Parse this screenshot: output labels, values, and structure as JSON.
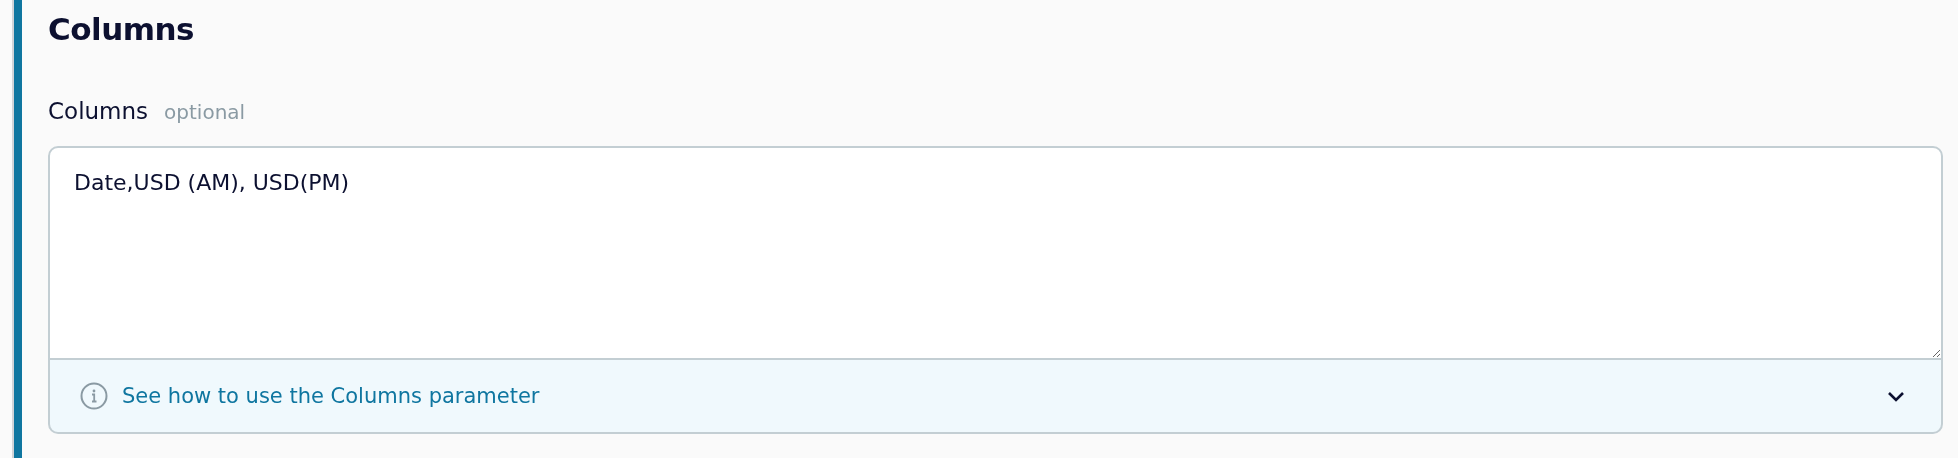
{
  "section": {
    "title": "Columns"
  },
  "field": {
    "label": "Columns",
    "hint": "optional",
    "value": "Date,USD (AM), USD(PM)"
  },
  "help": {
    "text": "See how to use the Columns parameter",
    "expanded": false
  }
}
